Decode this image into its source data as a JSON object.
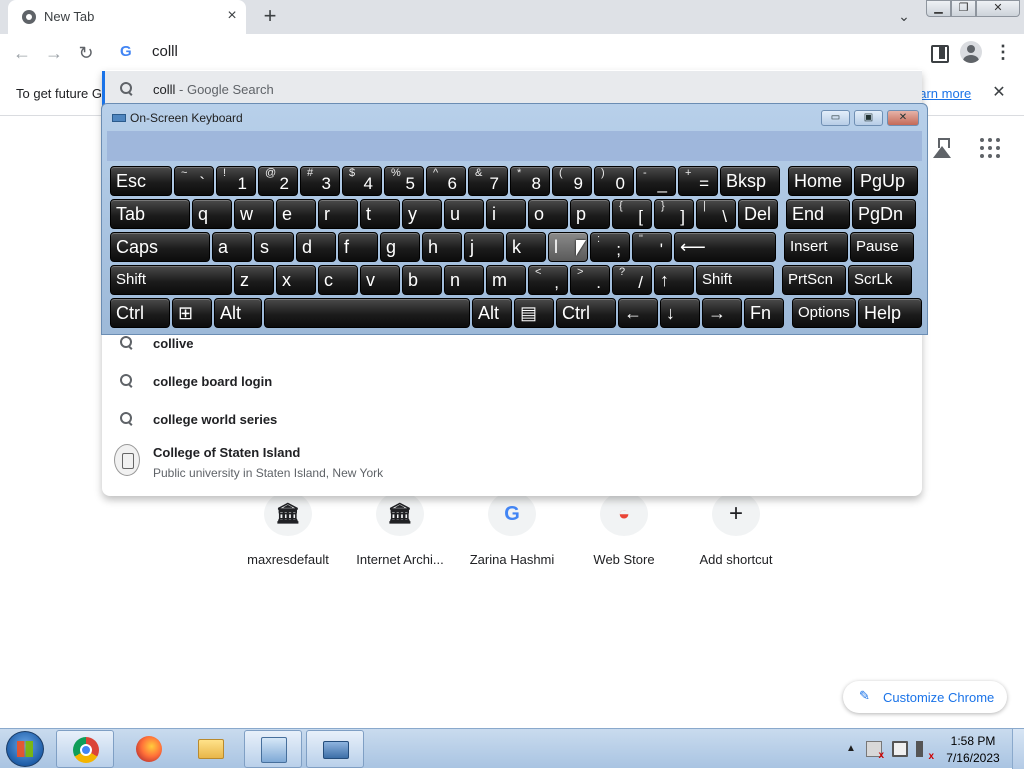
{
  "browser": {
    "tab": {
      "title": "New Tab",
      "close_glyph": "×"
    },
    "new_tab_glyph": "+",
    "tab_search_glyph": "⌄",
    "window_buttons": {
      "minimize": "▁",
      "maximize": "❐",
      "close": "✕"
    },
    "nav": {
      "back": "←",
      "forward": "→",
      "reload": "↻"
    },
    "omnibox": {
      "value": "colll",
      "g_icon": "G"
    },
    "menu_glyph": "⋮"
  },
  "infobar": {
    "text": "To get future G",
    "link": "earn more",
    "close_glyph": "✕"
  },
  "suggestions": [
    {
      "text": "colll",
      "suffix": " - Google Search",
      "selected": true
    },
    {
      "text": "collive"
    },
    {
      "text": "college board login"
    },
    {
      "text": "college world series"
    }
  ],
  "entity_suggestion": {
    "title": "College of Staten Island",
    "description": "Public university in Staten Island, New York"
  },
  "shortcuts": [
    {
      "label": "maxresdefault",
      "glyph": "🏛",
      "icon": "bank-icon"
    },
    {
      "label": "Internet Archi...",
      "glyph": "🏛",
      "icon": "bank-icon"
    },
    {
      "label": "Zarina Hashmi",
      "glyph": "G",
      "icon": "google-icon"
    },
    {
      "label": "Web Store",
      "glyph": "◒",
      "icon": "web-store-icon"
    },
    {
      "label": "Add shortcut",
      "glyph": "+",
      "icon": "plus-icon"
    }
  ],
  "customize": {
    "label": "Customize Chrome",
    "icon_glyph": "✎"
  },
  "osk": {
    "title": "On-Screen Keyboard",
    "window_buttons": {
      "minimize": "▭",
      "restore": "▣",
      "close": "✕"
    },
    "rows": [
      [
        {
          "main": "Esc"
        },
        {
          "sub": "~",
          "base": "`"
        },
        {
          "sub": "!",
          "base": "1"
        },
        {
          "sub": "@",
          "base": "2"
        },
        {
          "sub": "#",
          "base": "3"
        },
        {
          "sub": "$",
          "base": "4"
        },
        {
          "sub": "%",
          "base": "5"
        },
        {
          "sub": "^",
          "base": "6"
        },
        {
          "sub": "&",
          "base": "7"
        },
        {
          "sub": "*",
          "base": "8"
        },
        {
          "sub": "(",
          "base": "9"
        },
        {
          "sub": ")",
          "base": "0"
        },
        {
          "sub": "-",
          "base": "_"
        },
        {
          "sub": "+",
          "base": "="
        },
        {
          "main": "Bksp"
        },
        {
          "main": "Home"
        },
        {
          "main": "PgUp"
        }
      ],
      [
        {
          "main": "Tab"
        },
        {
          "main": "q"
        },
        {
          "main": "w"
        },
        {
          "main": "e"
        },
        {
          "main": "r"
        },
        {
          "main": "t"
        },
        {
          "main": "y"
        },
        {
          "main": "u"
        },
        {
          "main": "i"
        },
        {
          "main": "o"
        },
        {
          "main": "p"
        },
        {
          "sub": "{",
          "base": "["
        },
        {
          "sub": "}",
          "base": "]"
        },
        {
          "sub": "|",
          "base": "\\"
        },
        {
          "main": "Del"
        },
        {
          "main": "End"
        },
        {
          "main": "PgDn"
        }
      ],
      [
        {
          "main": "Caps"
        },
        {
          "main": "a"
        },
        {
          "main": "s"
        },
        {
          "main": "d"
        },
        {
          "main": "f"
        },
        {
          "main": "g"
        },
        {
          "main": "h"
        },
        {
          "main": "j"
        },
        {
          "main": "k"
        },
        {
          "main": "l"
        },
        {
          "sub": ":",
          "base": ";"
        },
        {
          "sub": "\"",
          "base": "'"
        },
        {
          "main": "⟵"
        },
        {
          "main": "Insert"
        },
        {
          "main": "Pause"
        }
      ],
      [
        {
          "main": "Shift"
        },
        {
          "main": "z"
        },
        {
          "main": "x"
        },
        {
          "main": "c"
        },
        {
          "main": "v"
        },
        {
          "main": "b"
        },
        {
          "main": "n"
        },
        {
          "main": "m"
        },
        {
          "sub": "<",
          "base": ","
        },
        {
          "sub": ">",
          "base": "."
        },
        {
          "sub": "?",
          "base": "/"
        },
        {
          "main": "↑"
        },
        {
          "main": "Shift"
        },
        {
          "main": "PrtScn"
        },
        {
          "main": "ScrLk"
        }
      ],
      [
        {
          "main": "Ctrl"
        },
        {
          "main": "⊞"
        },
        {
          "main": "Alt"
        },
        {
          "main": ""
        },
        {
          "main": "Alt"
        },
        {
          "main": "▤"
        },
        {
          "main": "Ctrl"
        },
        {
          "main": "←"
        },
        {
          "main": "↓"
        },
        {
          "main": "→"
        },
        {
          "main": "Fn"
        },
        {
          "main": "Options"
        },
        {
          "main": "Help"
        }
      ]
    ],
    "hovered_key": "l"
  },
  "taskbar": {
    "apps": [
      "start",
      "chrome",
      "firefox",
      "explorer",
      "control-panel",
      "on-screen-keyboard"
    ],
    "tray_arrow": "▲",
    "clock": {
      "time": "1:58 PM",
      "date": "7/16/2023"
    }
  }
}
